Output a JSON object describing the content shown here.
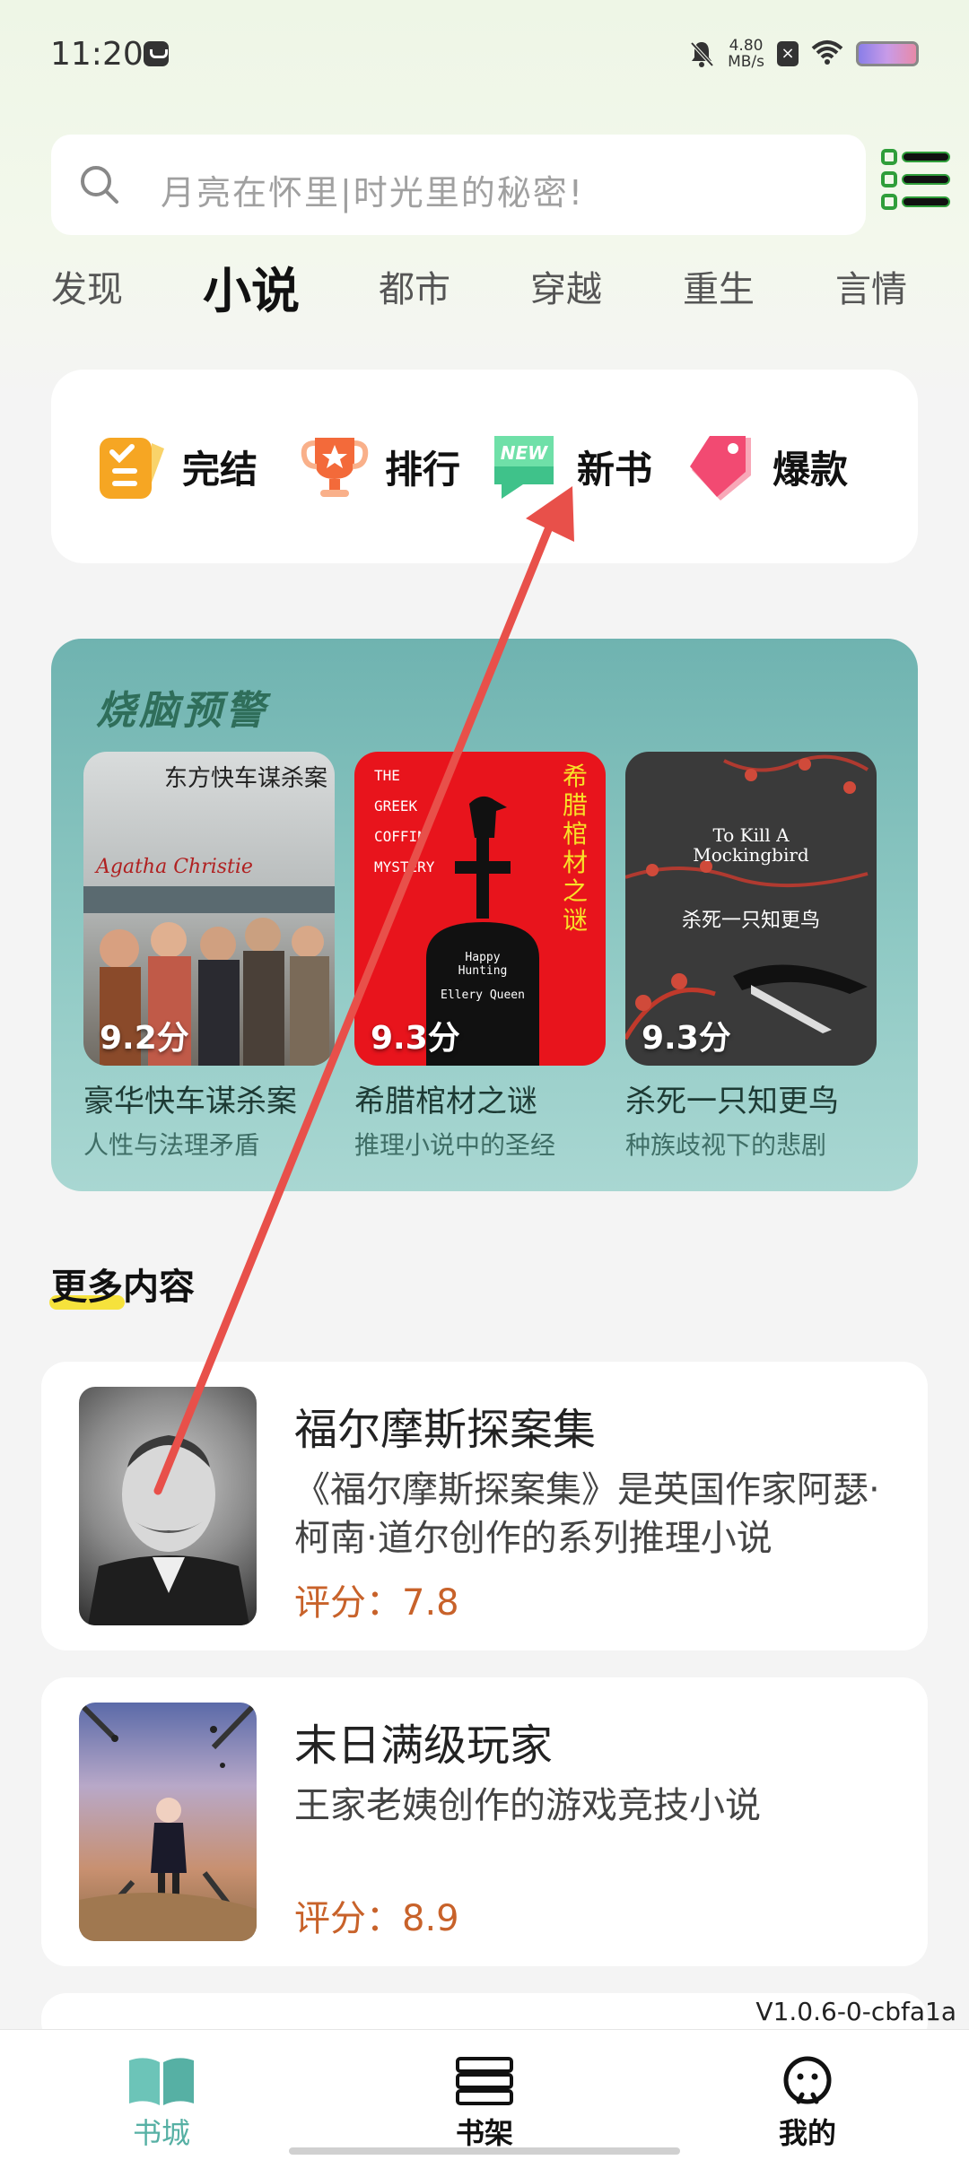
{
  "status_bar": {
    "time": "11:20",
    "net_speed_value": "4.80",
    "net_speed_unit": "MB/s"
  },
  "search": {
    "placeholder": "月亮在怀里|时光里的秘密!"
  },
  "tabs": [
    "发现",
    "小说",
    "都市",
    "穿越",
    "重生",
    "言情"
  ],
  "active_tab": "小说",
  "quick_links": [
    "完结",
    "排行",
    "新书",
    "爆款"
  ],
  "featured": {
    "title": "烧脑预警",
    "books": [
      {
        "cover_title": "东方快车谋杀案",
        "cover_author": "Agatha Christie",
        "score": "9.2分",
        "title": "豪华快车谋杀案",
        "subtitle": "人性与法理矛盾"
      },
      {
        "cover_title": "希腊棺材之谜",
        "cover_en_lines": [
          "THE",
          "GREEK",
          "COFFIN",
          "MYSTERY"
        ],
        "cover_bottom": "Happy Hunting",
        "cover_author": "Ellery Queen",
        "score": "9.3分",
        "title": "希腊棺材之谜",
        "subtitle": "推理小说中的圣经"
      },
      {
        "cover_en": "To Kill A Mockingbird",
        "cover_title": "杀死一只知更鸟",
        "score": "9.3分",
        "title": "杀死一只知更鸟",
        "subtitle": "种族歧视下的悲剧"
      }
    ]
  },
  "more": {
    "title": "更多内容",
    "items": [
      {
        "title": "福尔摩斯探案集",
        "desc": "《福尔摩斯探案集》是英国作家阿瑟·柯南·道尔创作的系列推理小说",
        "score": "评分：7.8"
      },
      {
        "title": "末日满级玩家",
        "desc": "王家老姨创作的游戏竞技小说",
        "score": "评分：8.9"
      }
    ]
  },
  "version": "V1.0.6-0-cbfa1a",
  "bottom_nav": [
    {
      "label": "书城",
      "icon": "open-book-icon",
      "active": true
    },
    {
      "label": "书架",
      "icon": "bookshelf-icon",
      "active": false
    },
    {
      "label": "我的",
      "icon": "profile-icon",
      "active": false
    }
  ],
  "colors": {
    "accent_green": "#56b0a4",
    "highlight_yellow": "#f6e23c",
    "score_orange": "#c8622a",
    "annotation_red": "#e8504a"
  }
}
